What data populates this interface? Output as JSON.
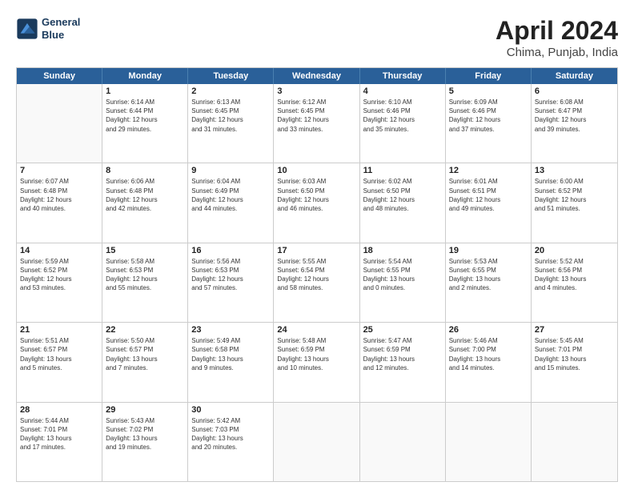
{
  "header": {
    "logo_line1": "General",
    "logo_line2": "Blue",
    "month": "April 2024",
    "location": "Chima, Punjab, India"
  },
  "weekdays": [
    "Sunday",
    "Monday",
    "Tuesday",
    "Wednesday",
    "Thursday",
    "Friday",
    "Saturday"
  ],
  "weeks": [
    [
      {
        "day": "",
        "info": ""
      },
      {
        "day": "1",
        "info": "Sunrise: 6:14 AM\nSunset: 6:44 PM\nDaylight: 12 hours\nand 29 minutes."
      },
      {
        "day": "2",
        "info": "Sunrise: 6:13 AM\nSunset: 6:45 PM\nDaylight: 12 hours\nand 31 minutes."
      },
      {
        "day": "3",
        "info": "Sunrise: 6:12 AM\nSunset: 6:45 PM\nDaylight: 12 hours\nand 33 minutes."
      },
      {
        "day": "4",
        "info": "Sunrise: 6:10 AM\nSunset: 6:46 PM\nDaylight: 12 hours\nand 35 minutes."
      },
      {
        "day": "5",
        "info": "Sunrise: 6:09 AM\nSunset: 6:46 PM\nDaylight: 12 hours\nand 37 minutes."
      },
      {
        "day": "6",
        "info": "Sunrise: 6:08 AM\nSunset: 6:47 PM\nDaylight: 12 hours\nand 39 minutes."
      }
    ],
    [
      {
        "day": "7",
        "info": "Sunrise: 6:07 AM\nSunset: 6:48 PM\nDaylight: 12 hours\nand 40 minutes."
      },
      {
        "day": "8",
        "info": "Sunrise: 6:06 AM\nSunset: 6:48 PM\nDaylight: 12 hours\nand 42 minutes."
      },
      {
        "day": "9",
        "info": "Sunrise: 6:04 AM\nSunset: 6:49 PM\nDaylight: 12 hours\nand 44 minutes."
      },
      {
        "day": "10",
        "info": "Sunrise: 6:03 AM\nSunset: 6:50 PM\nDaylight: 12 hours\nand 46 minutes."
      },
      {
        "day": "11",
        "info": "Sunrise: 6:02 AM\nSunset: 6:50 PM\nDaylight: 12 hours\nand 48 minutes."
      },
      {
        "day": "12",
        "info": "Sunrise: 6:01 AM\nSunset: 6:51 PM\nDaylight: 12 hours\nand 49 minutes."
      },
      {
        "day": "13",
        "info": "Sunrise: 6:00 AM\nSunset: 6:52 PM\nDaylight: 12 hours\nand 51 minutes."
      }
    ],
    [
      {
        "day": "14",
        "info": "Sunrise: 5:59 AM\nSunset: 6:52 PM\nDaylight: 12 hours\nand 53 minutes."
      },
      {
        "day": "15",
        "info": "Sunrise: 5:58 AM\nSunset: 6:53 PM\nDaylight: 12 hours\nand 55 minutes."
      },
      {
        "day": "16",
        "info": "Sunrise: 5:56 AM\nSunset: 6:53 PM\nDaylight: 12 hours\nand 57 minutes."
      },
      {
        "day": "17",
        "info": "Sunrise: 5:55 AM\nSunset: 6:54 PM\nDaylight: 12 hours\nand 58 minutes."
      },
      {
        "day": "18",
        "info": "Sunrise: 5:54 AM\nSunset: 6:55 PM\nDaylight: 13 hours\nand 0 minutes."
      },
      {
        "day": "19",
        "info": "Sunrise: 5:53 AM\nSunset: 6:55 PM\nDaylight: 13 hours\nand 2 minutes."
      },
      {
        "day": "20",
        "info": "Sunrise: 5:52 AM\nSunset: 6:56 PM\nDaylight: 13 hours\nand 4 minutes."
      }
    ],
    [
      {
        "day": "21",
        "info": "Sunrise: 5:51 AM\nSunset: 6:57 PM\nDaylight: 13 hours\nand 5 minutes."
      },
      {
        "day": "22",
        "info": "Sunrise: 5:50 AM\nSunset: 6:57 PM\nDaylight: 13 hours\nand 7 minutes."
      },
      {
        "day": "23",
        "info": "Sunrise: 5:49 AM\nSunset: 6:58 PM\nDaylight: 13 hours\nand 9 minutes."
      },
      {
        "day": "24",
        "info": "Sunrise: 5:48 AM\nSunset: 6:59 PM\nDaylight: 13 hours\nand 10 minutes."
      },
      {
        "day": "25",
        "info": "Sunrise: 5:47 AM\nSunset: 6:59 PM\nDaylight: 13 hours\nand 12 minutes."
      },
      {
        "day": "26",
        "info": "Sunrise: 5:46 AM\nSunset: 7:00 PM\nDaylight: 13 hours\nand 14 minutes."
      },
      {
        "day": "27",
        "info": "Sunrise: 5:45 AM\nSunset: 7:01 PM\nDaylight: 13 hours\nand 15 minutes."
      }
    ],
    [
      {
        "day": "28",
        "info": "Sunrise: 5:44 AM\nSunset: 7:01 PM\nDaylight: 13 hours\nand 17 minutes."
      },
      {
        "day": "29",
        "info": "Sunrise: 5:43 AM\nSunset: 7:02 PM\nDaylight: 13 hours\nand 19 minutes."
      },
      {
        "day": "30",
        "info": "Sunrise: 5:42 AM\nSunset: 7:03 PM\nDaylight: 13 hours\nand 20 minutes."
      },
      {
        "day": "",
        "info": ""
      },
      {
        "day": "",
        "info": ""
      },
      {
        "day": "",
        "info": ""
      },
      {
        "day": "",
        "info": ""
      }
    ]
  ]
}
